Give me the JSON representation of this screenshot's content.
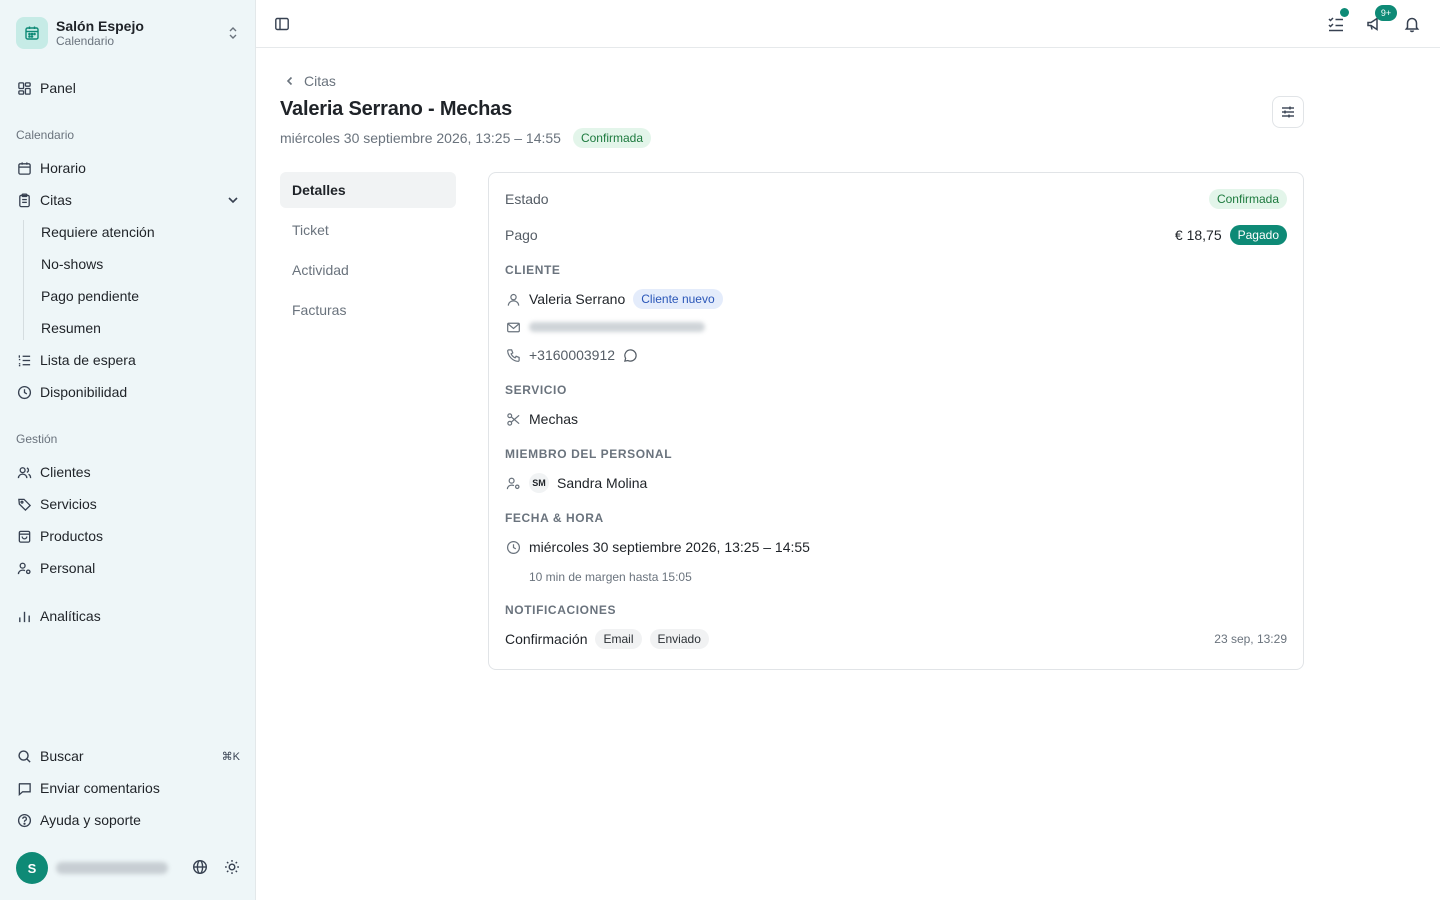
{
  "sidebar": {
    "brand_name": "Salón Espejo",
    "brand_sub": "Calendario",
    "panel": "Panel",
    "section_calendar": "Calendario",
    "horario": "Horario",
    "citas": "Citas",
    "citas_sub": [
      "Requiere atención",
      "No-shows",
      "Pago pendiente",
      "Resumen"
    ],
    "lista_espera": "Lista de espera",
    "disponibilidad": "Disponibilidad",
    "section_gestion": "Gestión",
    "clientes": "Clientes",
    "servicios": "Servicios",
    "productos": "Productos",
    "personal": "Personal",
    "analiticas": "Analíticas",
    "buscar": "Buscar",
    "buscar_shortcut": "⌘K",
    "enviar_comentarios": "Enviar comentarios",
    "ayuda": "Ayuda y soporte",
    "avatar_initial": "S"
  },
  "topbar": {
    "notifications_badge": "9+"
  },
  "page": {
    "breadcrumb": "Citas",
    "title": "Valeria Serrano - Mechas",
    "datetime": "miércoles 30 septiembre 2026, 13:25 – 14:55",
    "status": "Confirmada",
    "tabs": [
      "Detalles",
      "Ticket",
      "Actividad",
      "Facturas"
    ]
  },
  "details": {
    "estado_label": "Estado",
    "estado_value": "Confirmada",
    "pago_label": "Pago",
    "pago_amount": "€ 18,75",
    "pago_status": "Pagado",
    "cliente_section": "CLIENTE",
    "cliente_name": "Valeria Serrano",
    "cliente_tag": "Cliente nuevo",
    "cliente_phone": "+3160003912",
    "servicio_section": "SERVICIO",
    "servicio_name": "Mechas",
    "personal_section": "MIEMBRO DEL PERSONAL",
    "personal_initials": "SM",
    "personal_name": "Sandra Molina",
    "fecha_section": "FECHA & HORA",
    "fecha_value": "miércoles 30 septiembre 2026, 13:25 – 14:55",
    "fecha_note": "10 min de margen hasta 15:05",
    "notif_section": "NOTIFICACIONES",
    "notif_label": "Confirmación",
    "notif_channel": "Email",
    "notif_status": "Enviado",
    "notif_time": "23 sep, 13:29"
  },
  "colors": {
    "accent": "#0e8a76",
    "sidebar_bg": "#eef6f8",
    "success_bg": "#e3f5ea",
    "info_bg": "#e4ecfb"
  }
}
